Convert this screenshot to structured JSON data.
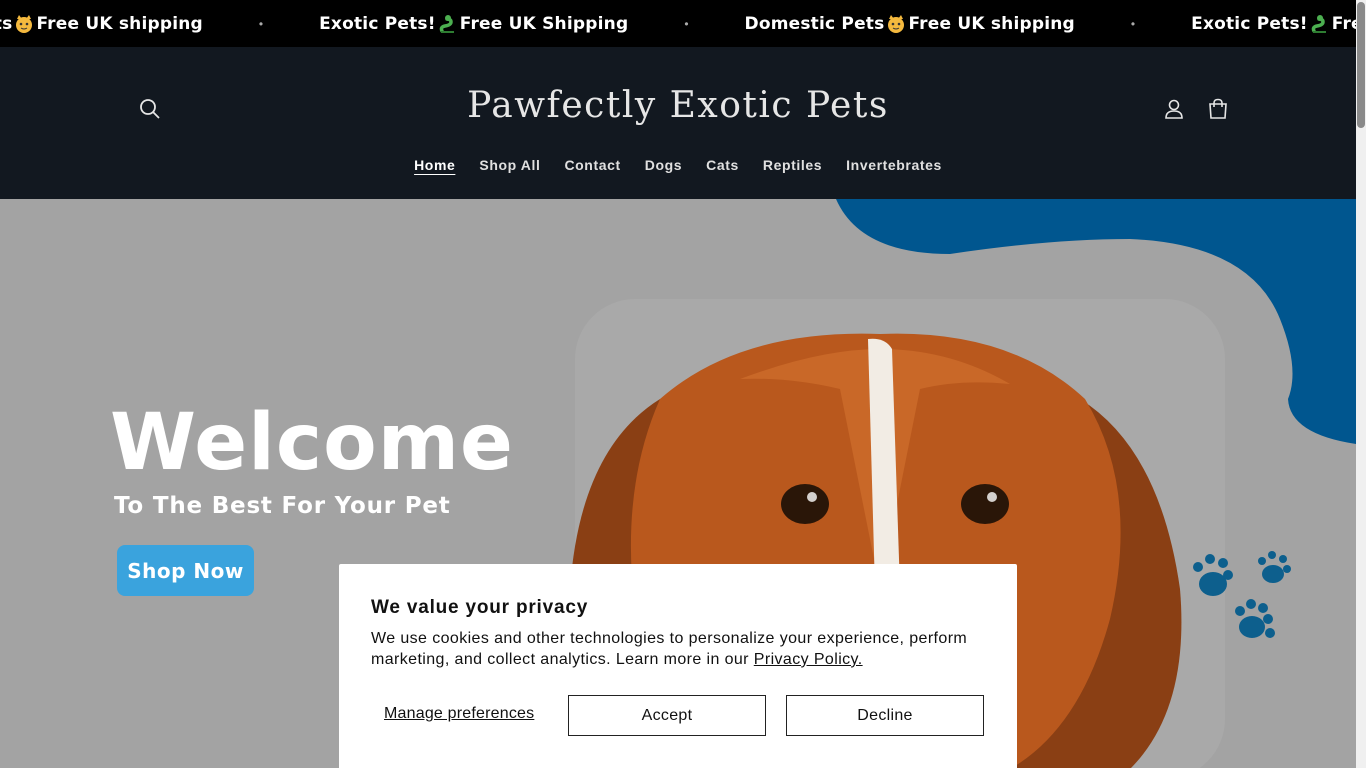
{
  "announcement": {
    "items": [
      {
        "text_before": "c Pets",
        "emoji": "cat-face-icon",
        "text_after": "Free UK shipping"
      },
      {
        "text_before": "Exotic Pets!",
        "emoji": "snake-icon",
        "text_after": "Free UK Shipping"
      },
      {
        "text_before": "Domestic Pets",
        "emoji": "cat-face-icon",
        "text_after": "Free UK shipping"
      },
      {
        "text_before": "Exotic Pets!",
        "emoji": "snake-icon",
        "text_after": "Free UK"
      }
    ],
    "separator": "•"
  },
  "header": {
    "logo": "Pawfectly Exotic Pets",
    "nav": [
      {
        "label": "Home",
        "active": true
      },
      {
        "label": "Shop All"
      },
      {
        "label": "Contact"
      },
      {
        "label": "Dogs"
      },
      {
        "label": "Cats"
      },
      {
        "label": "Reptiles"
      },
      {
        "label": "Invertebrates"
      }
    ]
  },
  "hero": {
    "title": "Welcome",
    "subtitle": "To The Best For Your Pet",
    "cta": "Shop Now"
  },
  "cookie_banner": {
    "title": "We value your privacy",
    "body": "We use cookies and other technologies to personalize your experience, perform marketing, and collect analytics. Learn more in our ",
    "link": "Privacy Policy.",
    "manage": "Manage preferences",
    "accept": "Accept",
    "decline": "Decline"
  },
  "colors": {
    "header_bg": "#121820",
    "hero_bg": "#a3a3a3",
    "accent_blue": "#00568f",
    "cta_blue": "#3aa3dd"
  }
}
